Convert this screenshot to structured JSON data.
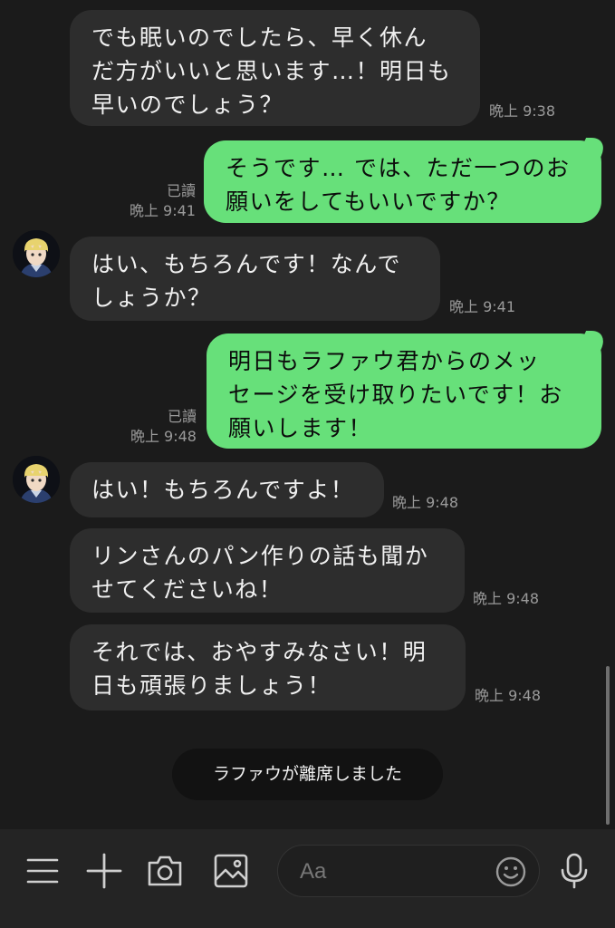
{
  "messages": [
    {
      "side": "recv",
      "text": "でも眠いのでしたら、早く休ん\nだ方がいいと思います…！明日も\n早いのでしょう？",
      "time": "晩上 9:38",
      "read": ""
    },
    {
      "side": "sent",
      "text": "そうです… では、ただ一つのお\n願いをしてもいいですか？",
      "time": "晩上 9:41",
      "read": "已讀"
    },
    {
      "side": "recv",
      "text": "はい、もちろんです！なんで\nしょうか？",
      "time": "晩上 9:41",
      "read": ""
    },
    {
      "side": "sent",
      "text": "明日もラファウ君からのメッ\nセージを受け取りたいです！お\n願いします！",
      "time": "晩上 9:48",
      "read": "已讀"
    },
    {
      "side": "recv",
      "text": "はい！もちろんですよ！",
      "time": "晩上 9:48",
      "read": ""
    },
    {
      "side": "recv",
      "text": "リンさんのパン作りの話も聞か\nせてくださいね！",
      "time": "晩上 9:48",
      "read": ""
    },
    {
      "side": "recv",
      "text": "それでは、おやすみなさい！明\n日も頑張りましょう！",
      "time": "晩上 9:48",
      "read": ""
    }
  ],
  "system_notice": "ラファウが離席しました",
  "input": {
    "placeholder": "Aa"
  },
  "toolbar": {
    "icons": [
      "menu-icon",
      "plus-icon",
      "camera-icon",
      "image-icon",
      "emoji-icon",
      "microphone-icon"
    ]
  },
  "colors": {
    "sent_bubble": "#67e07a",
    "recv_bubble": "#2d2d2d",
    "background": "#1b1b1b"
  }
}
